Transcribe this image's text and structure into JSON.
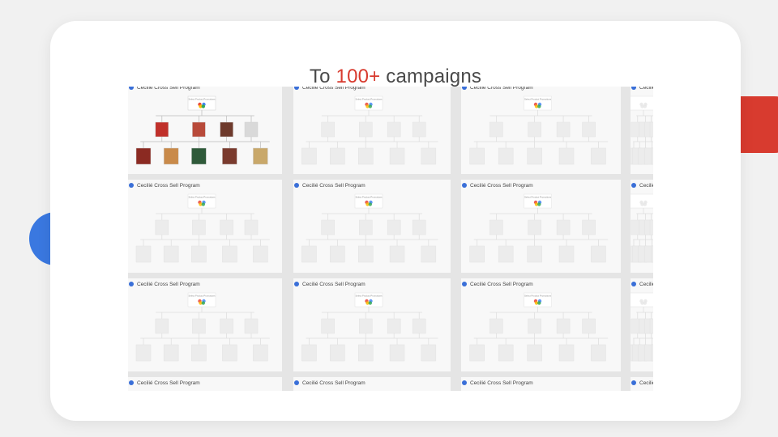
{
  "headline": {
    "prefix": "To ",
    "highlight": "100+",
    "suffix": " campaigns"
  },
  "colors": {
    "accent_red": "#d83b2f",
    "accent_blue": "#3a78e0",
    "tile_dot": "#3a6fd8"
  },
  "tiles": [
    {
      "label": "Cecilié Cross Sell Program",
      "node_label": "Select Product Promotions",
      "icon": "google-cloud-icon",
      "detailed": true
    },
    {
      "label": "Cecilié Cross Sell Program",
      "node_label": "Select Product Promotions",
      "icon": "google-cloud-icon",
      "detailed": false
    },
    {
      "label": "Cecilié Cross Sell Program",
      "node_label": "Select Product Promotions",
      "icon": "google-cloud-icon",
      "detailed": false
    },
    {
      "label": "Cecilié Cross Sell Program",
      "node_label": "",
      "icon": "google-cloud-icon",
      "detailed": false
    },
    {
      "label": "Cecilié Cross Sell Program",
      "node_label": "Select Product Promotions",
      "icon": "google-cloud-icon",
      "detailed": false
    },
    {
      "label": "Cecilié Cross Sell Program",
      "node_label": "Select Product Promotions",
      "icon": "google-cloud-icon",
      "detailed": false
    },
    {
      "label": "Cecilié Cross Sell Program",
      "node_label": "Select Product Promotions",
      "icon": "google-cloud-icon",
      "detailed": false
    },
    {
      "label": "Cecilié Cross Sell Program",
      "node_label": "",
      "icon": "google-cloud-icon",
      "detailed": false
    },
    {
      "label": "Cecilié Cross Sell Program",
      "node_label": "Select Product Promotions",
      "icon": "google-cloud-icon",
      "detailed": false
    },
    {
      "label": "Cecilié Cross Sell Program",
      "node_label": "Select Product Promotions",
      "icon": "google-cloud-icon",
      "detailed": false
    },
    {
      "label": "Cecilié Cross Sell Program",
      "node_label": "Select Product Promotions",
      "icon": "google-cloud-icon",
      "detailed": false
    },
    {
      "label": "Cecilié Cross Sell Program",
      "node_label": "",
      "icon": "google-cloud-icon",
      "detailed": false
    },
    {
      "label": "Cecilié Cross Sell Program",
      "node_label": "",
      "icon": "google-cloud-icon",
      "detailed": false
    },
    {
      "label": "Cecilié Cross Sell Program",
      "node_label": "",
      "icon": "google-cloud-icon",
      "detailed": false
    },
    {
      "label": "Cecilié Cross Sell Program",
      "node_label": "",
      "icon": "google-cloud-icon",
      "detailed": false
    },
    {
      "label": "Cecilié Cross Sell Program",
      "node_label": "",
      "icon": "google-cloud-icon",
      "detailed": false
    }
  ]
}
